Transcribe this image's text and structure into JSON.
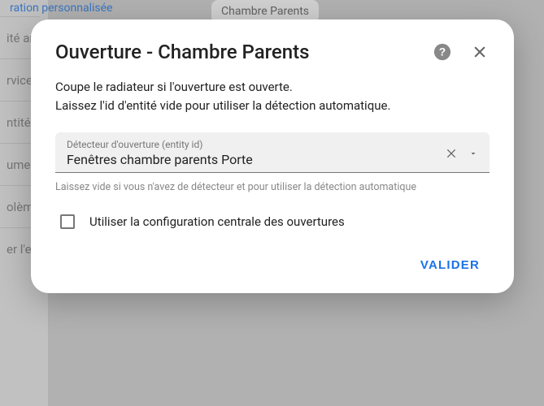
{
  "background": {
    "link": "ration personnalisée",
    "chip": "Chambre Parents",
    "items": [
      "ité ar",
      "rvices",
      "ntités",
      "umen",
      "olème",
      "er l'e"
    ]
  },
  "dialog": {
    "title": "Ouverture - Chambre Parents",
    "description_line1": "Coupe le radiateur si l'ouverture est ouverte.",
    "description_line2": "Laissez l'id d'entité vide pour utiliser la détection automatique.",
    "field": {
      "label": "Détecteur d'ouverture (entity id)",
      "value": "Fenêtres chambre parents Porte"
    },
    "helper": "Laissez vide si vous n'avez de détecteur et pour utiliser la détection automatique",
    "checkbox_label": "Utiliser la configuration centrale des ouvertures",
    "validate": "Valider"
  }
}
